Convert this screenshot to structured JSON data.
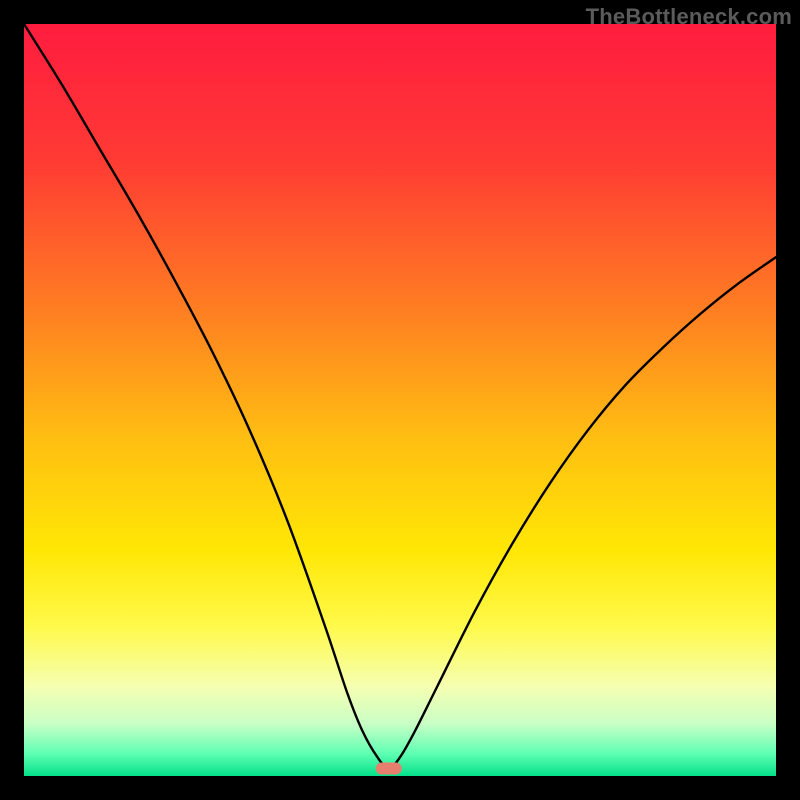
{
  "watermark": "TheBottleneck.com",
  "chart_data": {
    "type": "line",
    "title": "",
    "xlabel": "",
    "ylabel": "",
    "xlim": [
      0,
      100
    ],
    "ylim": [
      0,
      100
    ],
    "grid": false,
    "legend": false,
    "annotations": [],
    "background_gradient": {
      "stops": [
        {
          "pos": 0.0,
          "color": "#ff1c3f"
        },
        {
          "pos": 0.18,
          "color": "#ff3a34"
        },
        {
          "pos": 0.38,
          "color": "#ff7e22"
        },
        {
          "pos": 0.55,
          "color": "#ffbe12"
        },
        {
          "pos": 0.7,
          "color": "#ffe705"
        },
        {
          "pos": 0.8,
          "color": "#fff94a"
        },
        {
          "pos": 0.88,
          "color": "#f6ffb0"
        },
        {
          "pos": 0.93,
          "color": "#caffc6"
        },
        {
          "pos": 0.97,
          "color": "#5fffb2"
        },
        {
          "pos": 1.0,
          "color": "#05e08b"
        }
      ]
    },
    "marker": {
      "x": 48.5,
      "y": 1.0,
      "color": "#e77f6f"
    },
    "series": [
      {
        "name": "bottleneck-curve",
        "x": [
          0,
          5,
          10,
          15,
          20,
          25,
          30,
          35,
          40,
          43,
          45,
          47,
          48.5,
          50,
          52,
          55,
          60,
          65,
          70,
          75,
          80,
          85,
          90,
          95,
          100
        ],
        "y": [
          100,
          92,
          83.5,
          75,
          66,
          56.5,
          46,
          34,
          20,
          11,
          6,
          2.5,
          1,
          2.5,
          6,
          12,
          22,
          31,
          39,
          46,
          52,
          57,
          61.5,
          65.5,
          69
        ]
      }
    ]
  }
}
